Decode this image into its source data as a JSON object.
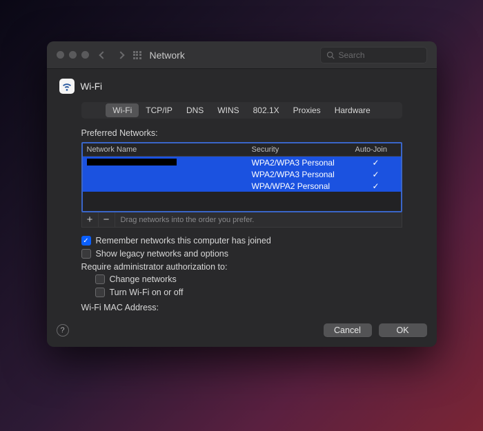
{
  "window": {
    "title": "Network",
    "search_placeholder": "Search"
  },
  "header": {
    "page_title": "Wi-Fi"
  },
  "tabs": [
    {
      "label": "Wi-Fi",
      "active": true
    },
    {
      "label": "TCP/IP",
      "active": false
    },
    {
      "label": "DNS",
      "active": false
    },
    {
      "label": "WINS",
      "active": false
    },
    {
      "label": "802.1X",
      "active": false
    },
    {
      "label": "Proxies",
      "active": false
    },
    {
      "label": "Hardware",
      "active": false
    }
  ],
  "preferred_networks": {
    "label": "Preferred Networks:",
    "columns": {
      "name": "Network Name",
      "security": "Security",
      "autojoin": "Auto-Join"
    },
    "rows": [
      {
        "name": "",
        "security": "WPA2/WPA3 Personal",
        "autojoin": true
      },
      {
        "name": "",
        "security": "WPA2/WPA3 Personal",
        "autojoin": true
      },
      {
        "name": "",
        "security": "WPA/WPA2 Personal",
        "autojoin": true
      }
    ],
    "add_label": "+",
    "remove_label": "−",
    "hint": "Drag networks into the order you prefer."
  },
  "options": {
    "remember": {
      "label": "Remember networks this computer has joined",
      "checked": true
    },
    "legacy": {
      "label": "Show legacy networks and options",
      "checked": false
    },
    "require_label": "Require administrator authorization to:",
    "change_networks": {
      "label": "Change networks",
      "checked": false
    },
    "turn_wifi": {
      "label": "Turn Wi-Fi on or off",
      "checked": false
    }
  },
  "mac_address": {
    "label": "Wi-Fi MAC Address:",
    "value": ""
  },
  "footer": {
    "cancel": "Cancel",
    "ok": "OK",
    "help": "?"
  }
}
